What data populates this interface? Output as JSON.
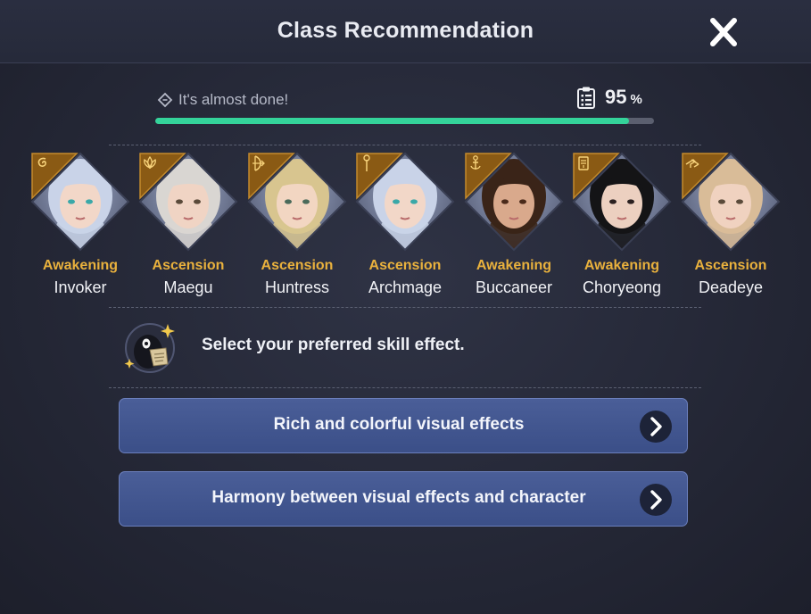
{
  "header": {
    "title": "Class Recommendation"
  },
  "progress": {
    "label": "It's almost done!",
    "value": 95,
    "unit": "%"
  },
  "classes": [
    {
      "type": "Awakening",
      "name": "Invoker",
      "hair": "#c9d3e8",
      "skin": "#f2d7c8",
      "eyes": "#3aa8a8",
      "emblem": "spiral-icon"
    },
    {
      "type": "Ascension",
      "name": "Maegu",
      "hair": "#d9d6d2",
      "skin": "#f0d4c4",
      "eyes": "#5a4a3a",
      "emblem": "lotus-icon"
    },
    {
      "type": "Ascension",
      "name": "Huntress",
      "hair": "#d8c58f",
      "skin": "#f2d6c2",
      "eyes": "#4a6a5a",
      "emblem": "bow-icon"
    },
    {
      "type": "Ascension",
      "name": "Archmage",
      "hair": "#c9d3e8",
      "skin": "#f2d7c8",
      "eyes": "#3aa8a8",
      "emblem": "staff-icon"
    },
    {
      "type": "Awakening",
      "name": "Buccaneer",
      "hair": "#3a2418",
      "skin": "#d9a98c",
      "eyes": "#4a2a1a",
      "emblem": "anchor-icon"
    },
    {
      "type": "Awakening",
      "name": "Choryeong",
      "hair": "#141416",
      "skin": "#ecd0c0",
      "eyes": "#2a2020",
      "emblem": "talisman-icon"
    },
    {
      "type": "Ascension",
      "name": "Deadeye",
      "hair": "#d9bc98",
      "skin": "#f0d2c0",
      "eyes": "#5a4a3a",
      "emblem": "pistols-icon"
    }
  ],
  "question": "Select your preferred skill effect.",
  "options": [
    {
      "label": "Rich and colorful visual effects"
    },
    {
      "label": "Harmony between visual effects and character"
    }
  ],
  "colors": {
    "accent": "#34d39a",
    "gold": "#e9b13d",
    "button": "#41558f"
  }
}
